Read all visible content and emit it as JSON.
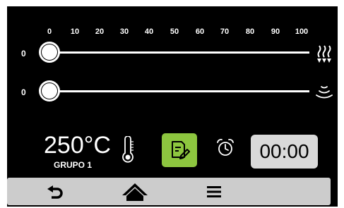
{
  "scale": {
    "ticks": [
      "0",
      "10",
      "20",
      "30",
      "40",
      "50",
      "60",
      "70",
      "80",
      "90",
      "100"
    ]
  },
  "slider1": {
    "value_label": "0",
    "value": 0,
    "icon": "heat-waves-down-icon"
  },
  "slider2": {
    "value_label": "0",
    "value": 0,
    "icon": "steam-icon"
  },
  "status": {
    "temperature": "250°C",
    "group": "GRUPO 1"
  },
  "buttons": {
    "notes_icon": "notes-edit-icon",
    "alarm_icon": "alarm-clock-icon"
  },
  "timer": {
    "value": "00:00"
  },
  "nav": {
    "items": [
      "back-icon",
      "home-icon",
      "menu-icon"
    ]
  },
  "colors": {
    "accent": "#8dc63f",
    "timer_bg": "#d9d9d9",
    "nav_bg": "#cccccc"
  }
}
